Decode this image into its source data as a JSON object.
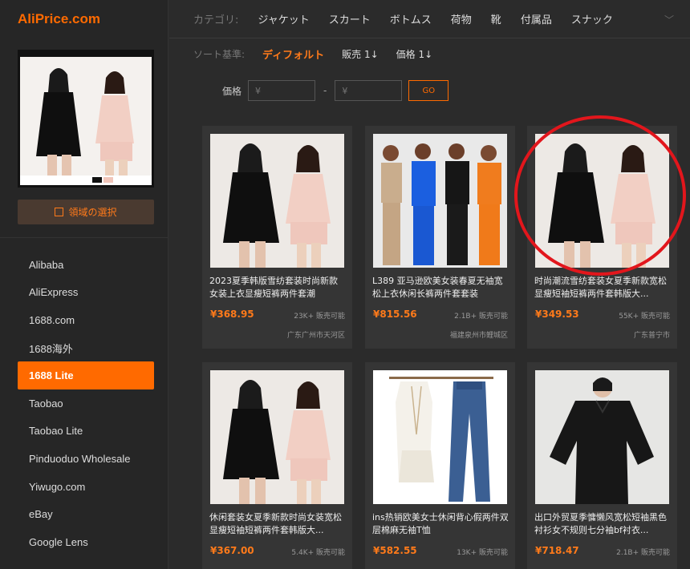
{
  "app": {
    "logo": "AliPrice.com"
  },
  "sidebar": {
    "select_area_label": "領域の選択",
    "platforms": [
      {
        "label": "Alibaba",
        "active": false
      },
      {
        "label": "AliExpress",
        "active": false
      },
      {
        "label": "1688.com",
        "active": false
      },
      {
        "label": "1688海外",
        "active": false
      },
      {
        "label": "1688 Lite",
        "active": true
      },
      {
        "label": "Taobao",
        "active": false
      },
      {
        "label": "Taobao Lite",
        "active": false
      },
      {
        "label": "Pinduoduo Wholesale",
        "active": false
      },
      {
        "label": "Yiwugo.com",
        "active": false
      },
      {
        "label": "eBay",
        "active": false
      },
      {
        "label": "Google Lens",
        "active": false
      }
    ]
  },
  "categories": {
    "label": "カテゴリ:",
    "items": [
      "ジャケット",
      "スカート",
      "ボトムス",
      "荷物",
      "靴",
      "付属品",
      "スナック"
    ]
  },
  "sort": {
    "label": "ソート基準:",
    "default": "ディフォルト",
    "sales": "販売 1↓",
    "price": "価格 1↓"
  },
  "price_filter": {
    "label": "価格",
    "min_placeholder": "¥",
    "max_placeholder": "¥",
    "go": "GO"
  },
  "products": [
    {
      "title": "2023夏季韩版雪纺套装时尚新款女装上衣显瘦短裤两件套潮",
      "price": "¥368.95",
      "sold": "23K+ 販売可能",
      "location": "广东广州市天河区",
      "image": "pink-black"
    },
    {
      "title": "L389 亚马逊欧美女装春夏无袖宽松上衣休闲长裤两件套套装",
      "price": "¥815.56",
      "sold": "2.1B+ 販売可能",
      "location": "福建泉州市鲤城区",
      "image": "four-models"
    },
    {
      "title": "时尚潮流雪纺套装女夏季新款宽松显瘦短袖短裤两件套韩版大...",
      "price": "¥349.53",
      "sold": "55K+ 販売可能",
      "location": "广东普宁市",
      "image": "pink-black"
    },
    {
      "title": "休闲套装女夏季新款时尚女装宽松显瘦短袖短裤两件套韩版大...",
      "price": "¥367.00",
      "sold": "5.4K+ 販売可能",
      "location": "",
      "image": "pink-black"
    },
    {
      "title": "ins热销欧美女士休闲背心假两件双层棉麻无袖T恤",
      "price": "¥582.55",
      "sold": "13K+ 販売可能",
      "location": "",
      "image": "white-tank"
    },
    {
      "title": "出口外贸夏季慵懒风宽松短袖黑色衬衫女不规则七分袖bf衬衣...",
      "price": "¥718.47",
      "sold": "2.1B+ 販売可能",
      "location": "",
      "image": "black-shirt"
    }
  ],
  "colors": {
    "accent": "#ff6a00",
    "annotation": "#e2161c"
  }
}
